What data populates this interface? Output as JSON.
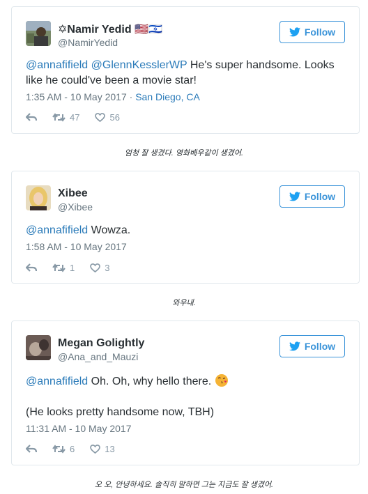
{
  "tweets": [
    {
      "name": "✡Namir Yedid 🇺🇸🇮🇱",
      "handle": "@NamirYedid",
      "follow_label": "Follow",
      "mention1": "@annafifield",
      "mention2": "@GlennKesslerWP",
      "text_line1_rest": " He's super handsome. Looks",
      "text_line2": "like he could've been a movie star!",
      "timestamp": "1:35 AM - 10 May 2017",
      "separator": " · ",
      "location": "San Diego, CA",
      "retweets": "47",
      "likes": "56"
    },
    {
      "name": "Xibee",
      "handle": "@Xibee",
      "follow_label": "Follow",
      "mention1": "@annafifield",
      "text_rest": " Wowza.",
      "timestamp": "1:58 AM - 10 May 2017",
      "retweets": "1",
      "likes": "3"
    },
    {
      "name": "Megan Golightly",
      "handle": "@Ana_and_Mauzi",
      "follow_label": "Follow",
      "mention1": "@annafifield",
      "text_rest": " Oh. Oh, why hello there. ",
      "emoji": "😘",
      "text_line2": "(He looks pretty handsome now, TBH)",
      "timestamp": "11:31 AM - 10 May 2017",
      "retweets": "6",
      "likes": "13"
    }
  ],
  "captions": [
    "엄청 잘 생겼다. 영화배우같이 생겼어.",
    "와우내.",
    "오 오, 안녕하세요. 솔직히 말하면 그는 지금도 잘 생겼어."
  ],
  "colors": {
    "accent": "#3b94d9",
    "link": "#2b7bb9",
    "muted": "#66757f",
    "emoji": "#f5b335"
  },
  "icons": [
    "twitter-bird-icon",
    "reply-icon",
    "retweet-icon",
    "heart-icon"
  ]
}
